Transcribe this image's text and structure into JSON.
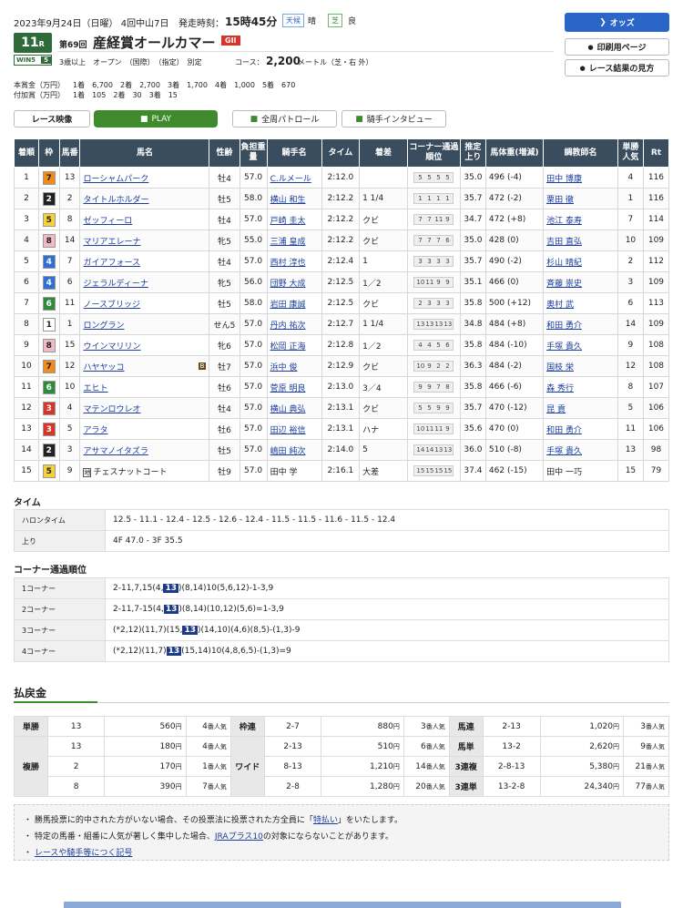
{
  "header": {
    "date": "2023年9月24日（日曜） 4回中山7日",
    "start_label": "発走時刻：",
    "start_time": "15時45分",
    "weather_label": "天候",
    "weather": "晴",
    "track_label": "芝",
    "track_cond": "良",
    "race_no": "11",
    "race_no_suffix": "R",
    "win5": "WIN5",
    "win5_no": "5",
    "edition": "第69回",
    "race_name": "産経賞オールカマー",
    "grade": "GII",
    "conditions": "3歳以上　オープン　（国際）　（指定）　別定",
    "course_label": "コース：",
    "distance": "2,200",
    "course_detail": "メートル（芝・右 外）",
    "prize_label": "本賞金（万円）",
    "prize": "1着　6,700　2着　2,700　3着　1,700　4着　1,000　5着　670",
    "addprize_label": "付加賞（万円）",
    "addprize": "1着　105　2着　30　3着　15"
  },
  "buttons": {
    "odds": "オッズ",
    "print": "印刷用ページ",
    "guide": "レース結果の見方",
    "video": "レース映像",
    "play": "PLAY",
    "patrol": "全周パトロール",
    "interview": "騎手インタビュー"
  },
  "table": {
    "headers": [
      "着順",
      "枠",
      "馬番",
      "馬名",
      "性齢",
      "負担重量",
      "騎手名",
      "タイム",
      "着差",
      "コーナー通過順位",
      "推定上り",
      "馬体重(増減)",
      "調教師名",
      "単勝人気",
      "Rt"
    ],
    "rows": [
      {
        "rank": "1",
        "waku": "7",
        "no": "13",
        "name": "ローシャムパーク",
        "sex": "牡4",
        "wt": "57.0",
        "jockey": "C.ルメール",
        "time": "2:12.0",
        "margin": "",
        "corner": [
          "5",
          "5",
          "5",
          "5"
        ],
        "last": "35.0",
        "bw": "496 (-4)",
        "trainer": "田中 博康",
        "pop": "4",
        "rt": "116"
      },
      {
        "rank": "2",
        "waku": "2",
        "no": "2",
        "name": "タイトルホルダー",
        "sex": "牡5",
        "wt": "58.0",
        "jockey": "横山 和生",
        "time": "2:12.2",
        "margin": "1 1/4",
        "corner": [
          "1",
          "1",
          "1",
          "1"
        ],
        "last": "35.7",
        "bw": "472 (-2)",
        "trainer": "栗田 徹",
        "pop": "1",
        "rt": "116"
      },
      {
        "rank": "3",
        "waku": "5",
        "no": "8",
        "name": "ゼッフィーロ",
        "sex": "牡4",
        "wt": "57.0",
        "jockey": "戸崎 圭太",
        "time": "2:12.2",
        "margin": "クビ",
        "corner": [
          "7",
          "7",
          "11",
          "9"
        ],
        "last": "34.7",
        "bw": "472 (+8)",
        "trainer": "池江 泰寿",
        "pop": "7",
        "rt": "114"
      },
      {
        "rank": "4",
        "waku": "8",
        "no": "14",
        "name": "マリアエレーナ",
        "sex": "牝5",
        "wt": "55.0",
        "jockey": "三浦 皇成",
        "time": "2:12.2",
        "margin": "クビ",
        "corner": [
          "7",
          "7",
          "7",
          "6"
        ],
        "last": "35.0",
        "bw": "428 (0)",
        "trainer": "吉田 直弘",
        "pop": "10",
        "rt": "109"
      },
      {
        "rank": "5",
        "waku": "4",
        "no": "7",
        "name": "ガイアフォース",
        "sex": "牡4",
        "wt": "57.0",
        "jockey": "西村 淳也",
        "time": "2:12.4",
        "margin": "1",
        "corner": [
          "3",
          "3",
          "3",
          "3"
        ],
        "last": "35.7",
        "bw": "490 (-2)",
        "trainer": "杉山 晴紀",
        "pop": "2",
        "rt": "112"
      },
      {
        "rank": "6",
        "waku": "4",
        "no": "6",
        "name": "ジェラルディーナ",
        "sex": "牝5",
        "wt": "56.0",
        "jockey": "団野 大成",
        "time": "2:12.5",
        "margin": "1／2",
        "corner": [
          "10",
          "11",
          "9",
          "9"
        ],
        "last": "35.1",
        "bw": "466 (0)",
        "trainer": "斉藤 崇史",
        "pop": "3",
        "rt": "109"
      },
      {
        "rank": "7",
        "waku": "6",
        "no": "11",
        "name": "ノースブリッジ",
        "sex": "牡5",
        "wt": "58.0",
        "jockey": "岩田 康誠",
        "time": "2:12.5",
        "margin": "クビ",
        "corner": [
          "2",
          "3",
          "3",
          "3"
        ],
        "last": "35.8",
        "bw": "500 (+12)",
        "trainer": "奥村 武",
        "pop": "6",
        "rt": "113"
      },
      {
        "rank": "8",
        "waku": "1",
        "no": "1",
        "name": "ロングラン",
        "sex": "せん5",
        "wt": "57.0",
        "jockey": "丹内 祐次",
        "time": "2:12.7",
        "margin": "1 1/4",
        "corner": [
          "13",
          "13",
          "13",
          "13"
        ],
        "last": "34.8",
        "bw": "484 (+8)",
        "trainer": "和田 勇介",
        "pop": "14",
        "rt": "109"
      },
      {
        "rank": "9",
        "waku": "8",
        "no": "15",
        "name": "ウインマリリン",
        "sex": "牝6",
        "wt": "57.0",
        "jockey": "松岡 正海",
        "time": "2:12.8",
        "margin": "1／2",
        "corner": [
          "4",
          "4",
          "5",
          "6"
        ],
        "last": "35.8",
        "bw": "484 (-10)",
        "trainer": "手塚 貴久",
        "pop": "9",
        "rt": "108"
      },
      {
        "rank": "10",
        "waku": "7",
        "no": "12",
        "name": "ハヤヤッコ",
        "sex": "牡7",
        "wt": "57.0",
        "jockey": "浜中 俊",
        "time": "2:12.9",
        "margin": "クビ",
        "corner": [
          "10",
          "9",
          "2",
          "2"
        ],
        "last": "36.3",
        "bw": "484 (-2)",
        "trainer": "国枝 栄",
        "pop": "12",
        "rt": "108",
        "blinker": "B"
      },
      {
        "rank": "11",
        "waku": "6",
        "no": "10",
        "name": "エヒト",
        "sex": "牡6",
        "wt": "57.0",
        "jockey": "菅原 明良",
        "time": "2:13.0",
        "margin": "3／4",
        "corner": [
          "9",
          "9",
          "7",
          "8"
        ],
        "last": "35.8",
        "bw": "466 (-6)",
        "trainer": "森 秀行",
        "pop": "8",
        "rt": "107"
      },
      {
        "rank": "12",
        "waku": "3",
        "no": "4",
        "name": "マテンロウレオ",
        "sex": "牡4",
        "wt": "57.0",
        "jockey": "横山 典弘",
        "time": "2:13.1",
        "margin": "クビ",
        "corner": [
          "5",
          "5",
          "9",
          "9"
        ],
        "last": "35.7",
        "bw": "470 (-12)",
        "trainer": "昆 貢",
        "pop": "5",
        "rt": "106"
      },
      {
        "rank": "13",
        "waku": "3",
        "no": "5",
        "name": "アラタ",
        "sex": "牡6",
        "wt": "57.0",
        "jockey": "田辺 裕信",
        "time": "2:13.1",
        "margin": "ハナ",
        "corner": [
          "10",
          "11",
          "11",
          "9"
        ],
        "last": "35.6",
        "bw": "470 (0)",
        "trainer": "和田 勇介",
        "pop": "11",
        "rt": "106"
      },
      {
        "rank": "14",
        "waku": "2",
        "no": "3",
        "name": "アサマノイタズラ",
        "sex": "牡5",
        "wt": "57.0",
        "jockey": "嶋田 純次",
        "time": "2:14.0",
        "margin": "5",
        "corner": [
          "14",
          "14",
          "13",
          "13"
        ],
        "last": "36.0",
        "bw": "510 (-8)",
        "trainer": "手塚 貴久",
        "pop": "13",
        "rt": "98"
      },
      {
        "rank": "15",
        "waku": "5",
        "no": "9",
        "name": "チェスナットコート",
        "sex": "牡9",
        "wt": "57.0",
        "jockey": "田中 学",
        "time": "2:16.1",
        "margin": "大差",
        "corner": [
          "15",
          "15",
          "15",
          "15"
        ],
        "last": "37.4",
        "bw": "462 (-15)",
        "trainer": "田中 一巧",
        "pop": "15",
        "rt": "79",
        "prefix": "地"
      }
    ]
  },
  "waku_colors": {
    "1": [
      "#ffffff",
      "#222"
    ],
    "2": [
      "#222222",
      "#fff"
    ],
    "3": [
      "#d9342b",
      "#fff"
    ],
    "4": [
      "#2f6fd6",
      "#fff"
    ],
    "5": [
      "#f5d23c",
      "#222"
    ],
    "6": [
      "#2f8a3a",
      "#fff"
    ],
    "7": [
      "#f08c1e",
      "#222"
    ],
    "8": [
      "#f4b9c8",
      "#222"
    ]
  },
  "time": {
    "title": "タイム",
    "haron_label": "ハロンタイム",
    "haron": "12.5 - 11.1 - 12.4 - 12.5 - 12.6 - 12.4 - 11.5 - 11.5 - 11.6 - 11.5 - 12.4",
    "agari_label": "上り",
    "agari": "4F 47.0 - 3F 35.5"
  },
  "corners": {
    "title": "コーナー通過順位",
    "rows": [
      {
        "label": "1コーナー",
        "pre": "2-11,7,15(4,",
        "hl": "13",
        "post": ")(8,14)10(5,6,12)-1-3,9"
      },
      {
        "label": "2コーナー",
        "pre": "2-11,7-15(4,",
        "hl": "13",
        "post": ")(8,14)(10,12)(5,6)=1-3,9"
      },
      {
        "label": "3コーナー",
        "pre": "(*2,12)(11,7)(15,",
        "hl": "13",
        "post": ")(14,10)(4,6)(8,5)-(1,3)-9"
      },
      {
        "label": "4コーナー",
        "pre": "(*2,12)(11,7)",
        "hl": "13",
        "post": "(15,14)10(4,8,6,5)-(1,3)=9"
      }
    ]
  },
  "payout": {
    "title": "払戻金",
    "tansho": "単勝",
    "fukusho": "複勝",
    "wakuren": "枠連",
    "wide": "ワイド",
    "umaren": "馬連",
    "umatan": "馬単",
    "sanfuku": "3連複",
    "santan": "3連単",
    "yen": "円",
    "popsuffix": "番人気",
    "tan": [
      [
        "13",
        "560",
        "4"
      ]
    ],
    "fuku": [
      [
        "13",
        "180",
        "4"
      ],
      [
        "2",
        "170",
        "1"
      ],
      [
        "8",
        "390",
        "7"
      ]
    ],
    "waku": [
      [
        "2-7",
        "880",
        "3"
      ]
    ],
    "wid": [
      [
        "2-13",
        "510",
        "6"
      ],
      [
        "8-13",
        "1,210",
        "14"
      ],
      [
        "2-8",
        "1,280",
        "20"
      ]
    ],
    "uren": [
      [
        "2-13",
        "1,020",
        "3"
      ]
    ],
    "utan": [
      [
        "13-2",
        "2,620",
        "9"
      ]
    ],
    "sfuku": [
      [
        "2-8-13",
        "5,380",
        "21"
      ]
    ],
    "stan": [
      [
        "13-2-8",
        "24,340",
        "77"
      ]
    ]
  },
  "notes": {
    "n1a": "勝馬投票に的中された方がいない場合、その投票法に投票された方全員に「",
    "n1link": "特払い",
    "n1b": "」をいたします。",
    "n2a": "特定の馬番・組番に人気が著しく集中した場合、",
    "n2link": "JRAプラス10",
    "n2b": "の対象にならないことがあります。",
    "n3link": "レースや騎手等につく記号"
  }
}
